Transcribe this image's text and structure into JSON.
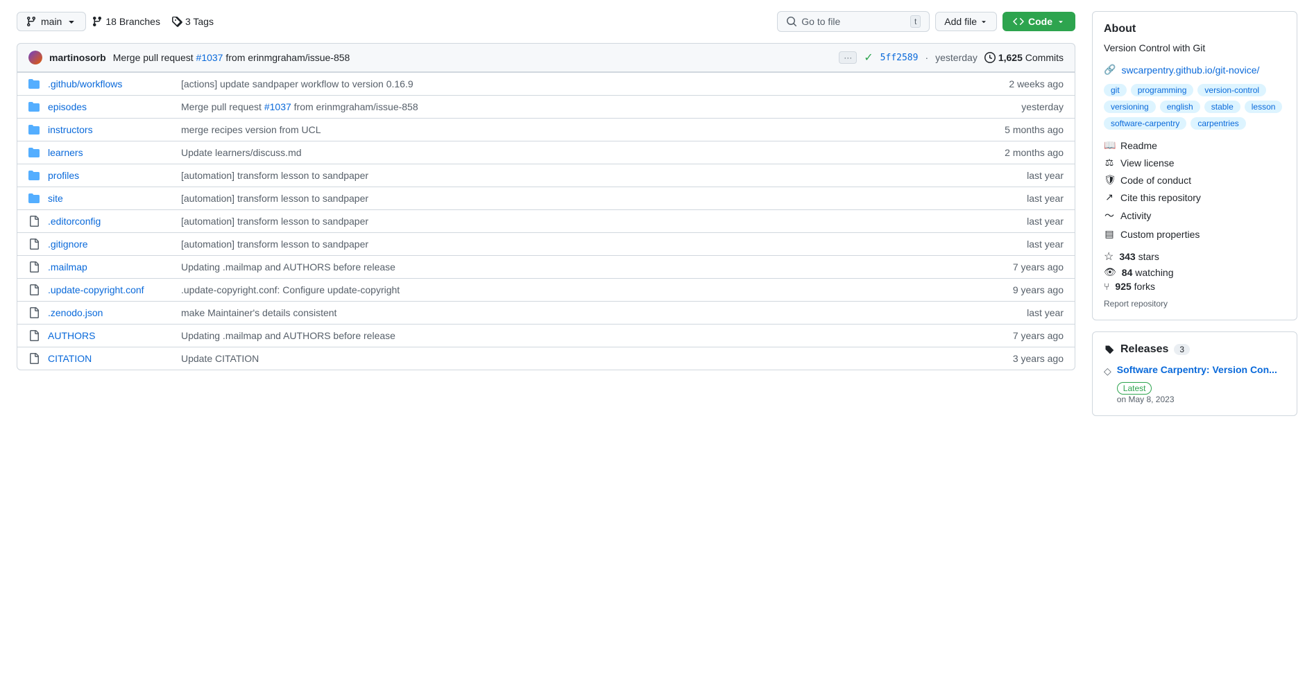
{
  "toolbar": {
    "branch_label": "main",
    "branches_label": "18 Branches",
    "tags_label": "3 Tags",
    "go_to_file_placeholder": "Go to file",
    "go_to_file_key": "t",
    "add_file_label": "Add file",
    "code_label": "Code"
  },
  "commit_bar": {
    "author": "martinosorb",
    "message_prefix": "Merge pull request",
    "pr_number": "#1037",
    "message_suffix": "from erinmgraham/issue-858",
    "hash": "5ff2589",
    "time": "yesterday",
    "commits_count": "1,625",
    "commits_label": "Commits"
  },
  "files": [
    {
      "type": "folder",
      "name": ".github/workflows",
      "commit": "[actions] update sandpaper workflow to version 0.16.9",
      "time": "2 weeks ago"
    },
    {
      "type": "folder",
      "name": "episodes",
      "commit": "Merge pull request #1037 from erinmgraham/issue-858",
      "time": "yesterday",
      "has_link": true,
      "link_text": "#1037",
      "link_url": "#"
    },
    {
      "type": "folder",
      "name": "instructors",
      "commit": "merge recipes version from UCL",
      "time": "5 months ago"
    },
    {
      "type": "folder",
      "name": "learners",
      "commit": "Update learners/discuss.md",
      "time": "2 months ago"
    },
    {
      "type": "folder",
      "name": "profiles",
      "commit": "[automation] transform lesson to sandpaper",
      "time": "last year"
    },
    {
      "type": "folder",
      "name": "site",
      "commit": "[automation] transform lesson to sandpaper",
      "time": "last year"
    },
    {
      "type": "file",
      "name": ".editorconfig",
      "commit": "[automation] transform lesson to sandpaper",
      "time": "last year"
    },
    {
      "type": "file",
      "name": ".gitignore",
      "commit": "[automation] transform lesson to sandpaper",
      "time": "last year"
    },
    {
      "type": "file",
      "name": ".mailmap",
      "commit": "Updating .mailmap and AUTHORS before release",
      "time": "7 years ago"
    },
    {
      "type": "file",
      "name": ".update-copyright.conf",
      "commit": ".update-copyright.conf: Configure update-copyright",
      "time": "9 years ago"
    },
    {
      "type": "file",
      "name": ".zenodo.json",
      "commit": "make Maintainer's details consistent",
      "time": "last year"
    },
    {
      "type": "file",
      "name": "AUTHORS",
      "commit": "Updating .mailmap and AUTHORS before release",
      "time": "7 years ago"
    },
    {
      "type": "file",
      "name": "CITATION",
      "commit": "Update CITATION",
      "time": "3 years ago"
    }
  ],
  "about": {
    "title": "About",
    "description": "Version Control with Git",
    "link_text": "swcarpentry.github.io/git-novice/",
    "link_url": "https://swcarpentry.github.io/git-novice/",
    "tags": [
      "git",
      "programming",
      "version-control",
      "versioning",
      "english",
      "stable",
      "lesson",
      "software-carpentry",
      "carpentries"
    ],
    "links": [
      {
        "label": "Readme",
        "icon": "book"
      },
      {
        "label": "View license",
        "icon": "scale"
      },
      {
        "label": "Code of conduct",
        "icon": "shield"
      },
      {
        "label": "Cite this repository",
        "icon": "cite"
      },
      {
        "label": "Activity",
        "icon": "activity"
      },
      {
        "label": "Custom properties",
        "icon": "prop"
      }
    ],
    "stars": "343",
    "stars_label": "stars",
    "watching": "84",
    "watching_label": "watching",
    "forks": "925",
    "forks_label": "forks",
    "report_label": "Report repository"
  },
  "releases": {
    "title": "Releases",
    "count": "3",
    "items": [
      {
        "name": "Software Carpentry: Version Con...",
        "date": "on May 8, 2023",
        "badge": "Latest"
      }
    ]
  }
}
